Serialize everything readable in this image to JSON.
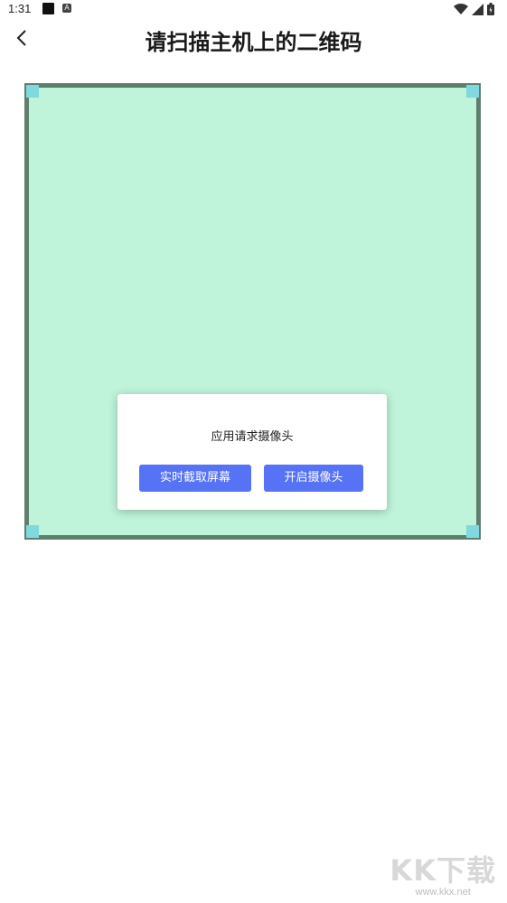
{
  "status_bar": {
    "time": "1:31",
    "badge": "A"
  },
  "header": {
    "title": "请扫描主机上的二维码",
    "back_icon": "chevron-left-icon"
  },
  "scanner": {
    "frame_color": "#5f7f6e",
    "fill_color": "#bff3da",
    "corner_color": "#7fd9df"
  },
  "dialog": {
    "message": "应用请求摄像头",
    "capture_button": "实时截取屏幕",
    "camera_button": "开启摄像头",
    "button_color": "#5672f5"
  },
  "watermark": {
    "logo": "KK下载",
    "url": "www.kkx.net"
  }
}
